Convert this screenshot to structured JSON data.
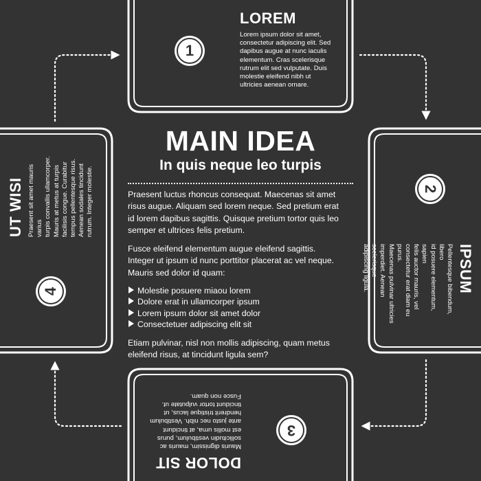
{
  "main": {
    "title": "MAIN IDEA",
    "subtitle": "In quis neque leo turpis",
    "paragraphs": [
      "Praesent luctus rhoncus consequat. Maecenas sit amet\nrisus augue. Aliquam sed lorem neque. Sed pretium erat\nid lorem dapibus sagittis. Quisque pretium tortor quis leo\nsemper et ultrices felis pretium.",
      "Fusce eleifend elementum augue eleifend sagittis.\nInteger ut ipsum id nunc porttitor placerat ac vel neque.\nMauris sed dolor id quam:",
      "Etiam pulvinar, nisl non mollis adipiscing, quam metus\neleifend risus, at tincidunt ligula sem?"
    ],
    "bullets": [
      "Molestie posuere miaou lorem",
      "Dolore erat in ullamcorper ipsum",
      "Lorem ipsum dolor sit amet dolor",
      "Consectetuer adipiscing elit sit"
    ]
  },
  "steps": [
    {
      "number": "1",
      "title": "LOREM",
      "text": "Lorem ipsum dolor sit amet,\nconsectetur adipiscing elit. Sed\ndapibus augue at nunc iaculis\nelementum. Cras scelerisque\nrutrum elit sed vulputate. Duis\nmolestie eleifend nibh ut\nultricies aenean ornare."
    },
    {
      "number": "2",
      "title": "IPSUM",
      "text": "Pellentesque bibendum, libero\nid posuere elementum, sapien\nfelis auctor mauris, vel\nconsectetur erat diam eu purus.\nMaecenas pulvinar ultricies\nimperdiet. Aenean scelerisque\nadipiscing ligula."
    },
    {
      "number": "3",
      "title": "DOLOR SIT",
      "text": "Mauris dignissim, mauris ac\nsollicitudin vestibulum, purus\nest mollis urna, at tincidunt\nante justo nec nibh. Vestibulum\nhendrerit tristique lacus, ut\ntincidunt tortor vulputate ut.\nFusce non quam."
    },
    {
      "number": "4",
      "title": "UT WISI",
      "text": "Praesent sit amet mauris varius\nturpis convallis ullamcorper.\nMauris at metus at turpis\nfacilisis congue. Curabitur\ntempus pellentesque risus.\nAenean sodales tincidunt\nrutrum. Integer molestie."
    }
  ],
  "colors": {
    "background": "#333333",
    "foreground": "#ffffff"
  }
}
